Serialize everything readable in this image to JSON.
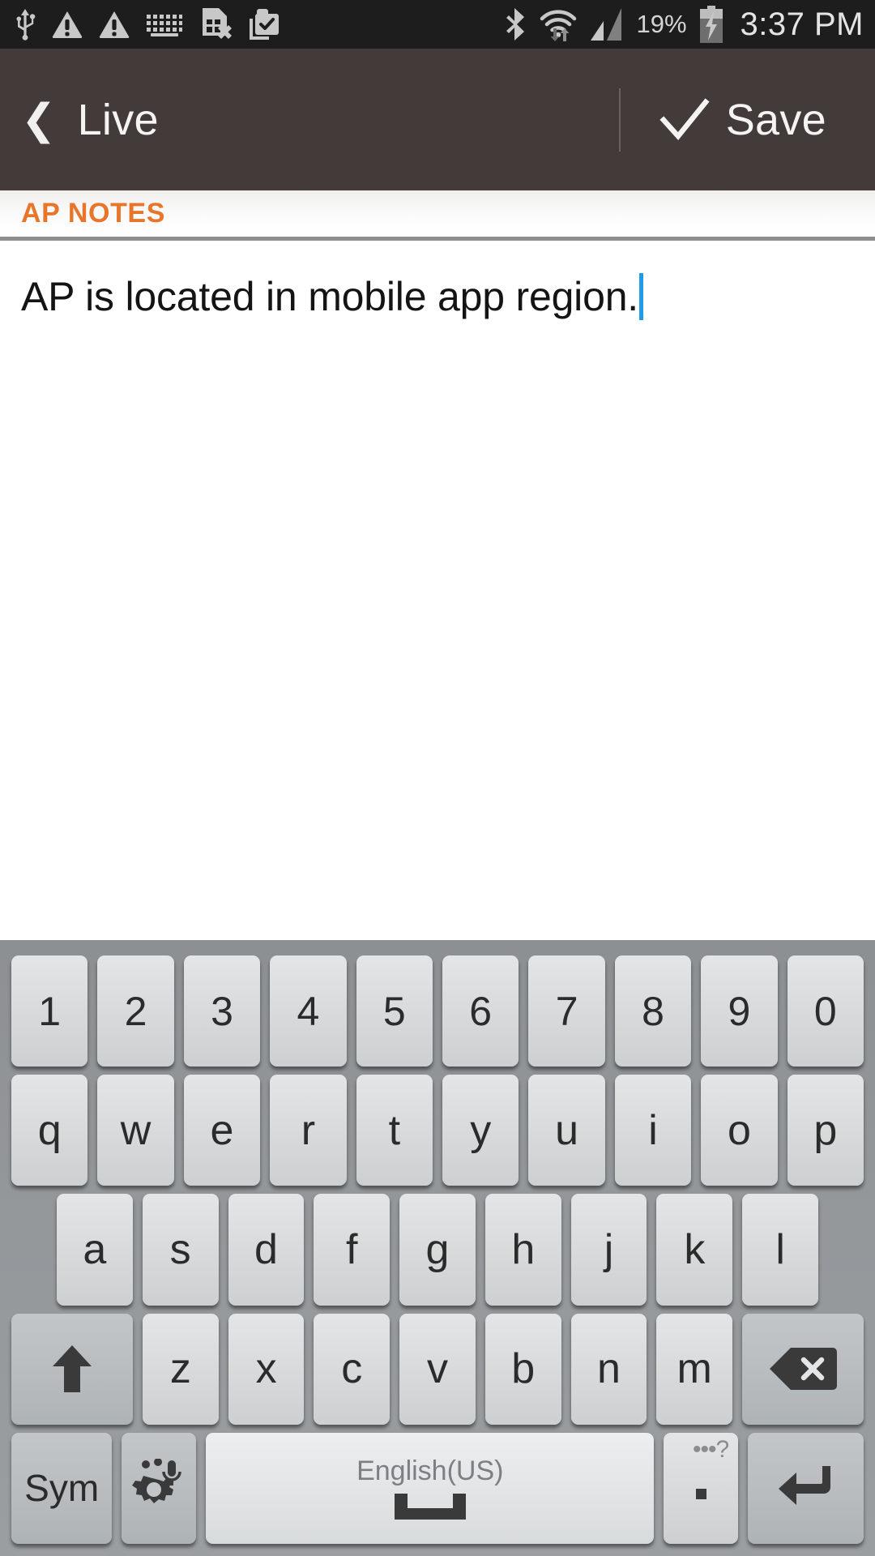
{
  "status_bar": {
    "icons": [
      "usb-icon",
      "warning-icon",
      "warning-icon",
      "keyboard-icon",
      "sim-card-error-icon",
      "work-profile-icon"
    ],
    "bluetooth": "bluetooth-icon",
    "wifi": "wifi-data-icon",
    "signal": "cellular-signal-icon",
    "battery_percent": "19%",
    "battery": "battery-charging-icon",
    "clock": "3:37 PM",
    "background": "#1d1d1d"
  },
  "action_bar": {
    "back_icon": "❮",
    "title": "Live",
    "save_icon": "check-icon",
    "save_label": "Save",
    "background": "#433b3a"
  },
  "section": {
    "title": "AP NOTES",
    "accent_color": "#e8762a"
  },
  "note": {
    "text": "AP is located in mobile app region.",
    "caret_color": "#1f9be8"
  },
  "keyboard": {
    "language": "English(US)",
    "sym_label": "Sym",
    "period_hint": "•••?",
    "period_label": ".",
    "rows": [
      {
        "name": "number-row",
        "keys": [
          "1",
          "2",
          "3",
          "4",
          "5",
          "6",
          "7",
          "8",
          "9",
          "0"
        ]
      },
      {
        "name": "top-row",
        "keys": [
          "q",
          "w",
          "e",
          "r",
          "t",
          "y",
          "u",
          "i",
          "o",
          "p"
        ]
      },
      {
        "name": "home-row",
        "keys": [
          "a",
          "s",
          "d",
          "f",
          "g",
          "h",
          "j",
          "k",
          "l"
        ]
      },
      {
        "name": "bottom-row",
        "keys": [
          "z",
          "x",
          "c",
          "v",
          "b",
          "n",
          "m"
        ]
      }
    ],
    "shift_icon": "shift-arrow-icon",
    "backspace_icon": "backspace-icon",
    "gear_icon": "settings-mic-icon",
    "enter_icon": "enter-arrow-icon",
    "background": "#93979a"
  }
}
